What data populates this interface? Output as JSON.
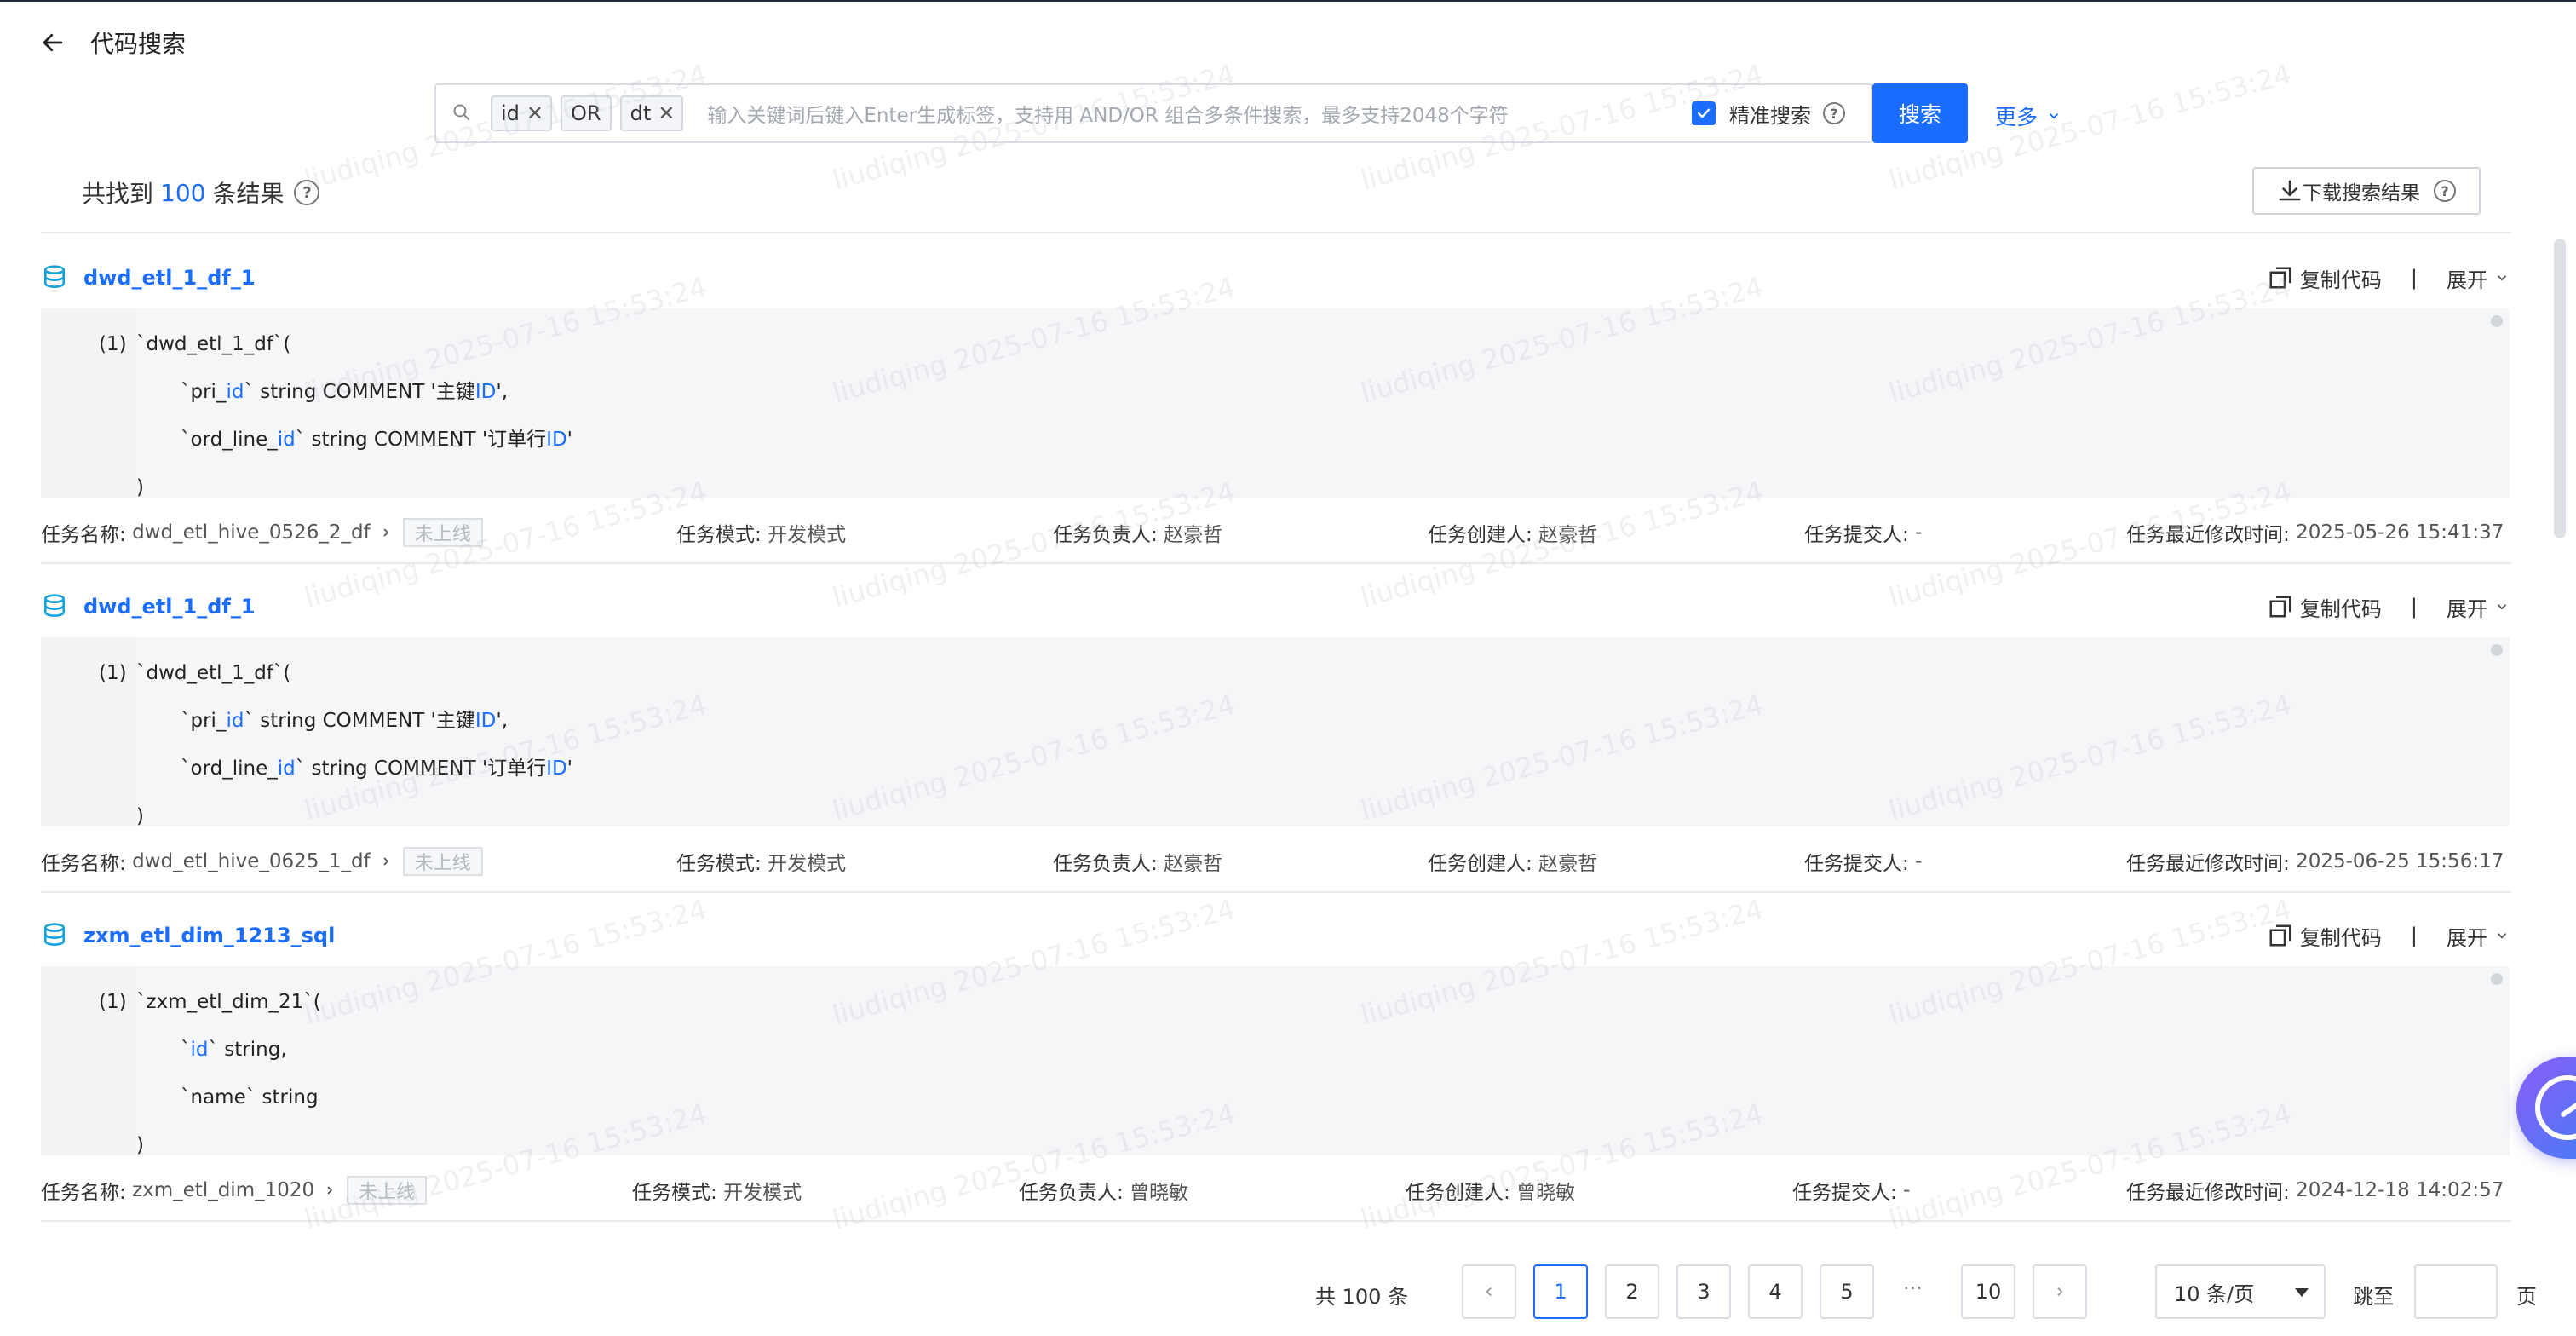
{
  "header": {
    "title": "代码搜索"
  },
  "search": {
    "tags": [
      {
        "label": "id",
        "removable": true
      },
      {
        "label": "OR",
        "removable": false
      },
      {
        "label": "dt",
        "removable": true
      }
    ],
    "placeholder": "输入关键词后键入Enter生成标签，支持用 AND/OR 组合多条件搜索，最多支持2048个字符",
    "precise_label": "精准搜索",
    "precise_checked": true,
    "button_label": "搜索",
    "more_label": "更多"
  },
  "summary": {
    "prefix": "共找到",
    "count": "100",
    "suffix": "条结果",
    "download_label": "下载搜索结果"
  },
  "actions": {
    "copy_label": "复制代码",
    "divider": "|",
    "expand_label": "展开"
  },
  "meta_labels": {
    "task_name": "任务名称:",
    "task_mode": "任务模式:",
    "owner": "任务负责人:",
    "creator": "任务创建人:",
    "submitter": "任务提交人:",
    "modified": "任务最近修改时间:"
  },
  "results": [
    {
      "name": "dwd_etl_1_df_1",
      "code": [
        {
          "no": "(1)",
          "parts": [
            {
              "t": "`dwd_etl_1_df`("
            }
          ]
        },
        {
          "no": "",
          "parts": [
            {
              "t": "`pri_"
            },
            {
              "t": "id",
              "h": true
            },
            {
              "t": "` string COMMENT '主键"
            },
            {
              "t": "ID",
              "h": true
            },
            {
              "t": "',"
            }
          ]
        },
        {
          "no": "",
          "parts": [
            {
              "t": "`ord_line_"
            },
            {
              "t": "id",
              "h": true
            },
            {
              "t": "` string COMMENT '订单行"
            },
            {
              "t": "ID",
              "h": true
            },
            {
              "t": "'"
            }
          ]
        },
        {
          "no": "",
          "parts": [
            {
              "t": ")"
            }
          ]
        }
      ],
      "task_name": "dwd_etl_hive_0526_2_df",
      "status": "未上线",
      "task_mode": "开发模式",
      "owner": "赵豪哲",
      "creator": "赵豪哲",
      "submitter": "-",
      "modified": "2025-05-26 15:41:37"
    },
    {
      "name": "dwd_etl_1_df_1",
      "code": [
        {
          "no": "(1)",
          "parts": [
            {
              "t": "`dwd_etl_1_df`("
            }
          ]
        },
        {
          "no": "",
          "parts": [
            {
              "t": "`pri_"
            },
            {
              "t": "id",
              "h": true
            },
            {
              "t": "` string COMMENT '主键"
            },
            {
              "t": "ID",
              "h": true
            },
            {
              "t": "',"
            }
          ]
        },
        {
          "no": "",
          "parts": [
            {
              "t": "`ord_line_"
            },
            {
              "t": "id",
              "h": true
            },
            {
              "t": "` string COMMENT '订单行"
            },
            {
              "t": "ID",
              "h": true
            },
            {
              "t": "'"
            }
          ]
        },
        {
          "no": "",
          "parts": [
            {
              "t": ")"
            }
          ]
        }
      ],
      "task_name": "dwd_etl_hive_0625_1_df",
      "status": "未上线",
      "task_mode": "开发模式",
      "owner": "赵豪哲",
      "creator": "赵豪哲",
      "submitter": "-",
      "modified": "2025-06-25 15:56:17"
    },
    {
      "name": "zxm_etl_dim_1213_sql",
      "code": [
        {
          "no": "(1)",
          "parts": [
            {
              "t": "`zxm_etl_dim_21`("
            }
          ]
        },
        {
          "no": "",
          "parts": [
            {
              "t": "`"
            },
            {
              "t": "id",
              "h": true
            },
            {
              "t": "` string,"
            }
          ]
        },
        {
          "no": "",
          "parts": [
            {
              "t": "`name` string"
            }
          ]
        },
        {
          "no": "",
          "parts": [
            {
              "t": ")"
            }
          ]
        }
      ],
      "task_name": "zxm_etl_dim_1020",
      "status": "未上线",
      "task_mode": "开发模式",
      "owner": "曾晓敏",
      "creator": "曾晓敏",
      "submitter": "-",
      "modified": "2024-12-18 14:02:57"
    }
  ],
  "pagination": {
    "total_label": "共 100 条",
    "pages": [
      "1",
      "2",
      "3",
      "4",
      "5"
    ],
    "ellipsis": "···",
    "last_page": "10",
    "current": "1",
    "page_size": "10 条/页",
    "jump_label": "跳至",
    "page_unit": "页"
  },
  "watermark": "liudiqing 2025-07-16 15:53:24",
  "colors": {
    "accent": "#1a6dff",
    "code_bg": "#f5f6f8",
    "border": "#d9dde3"
  }
}
